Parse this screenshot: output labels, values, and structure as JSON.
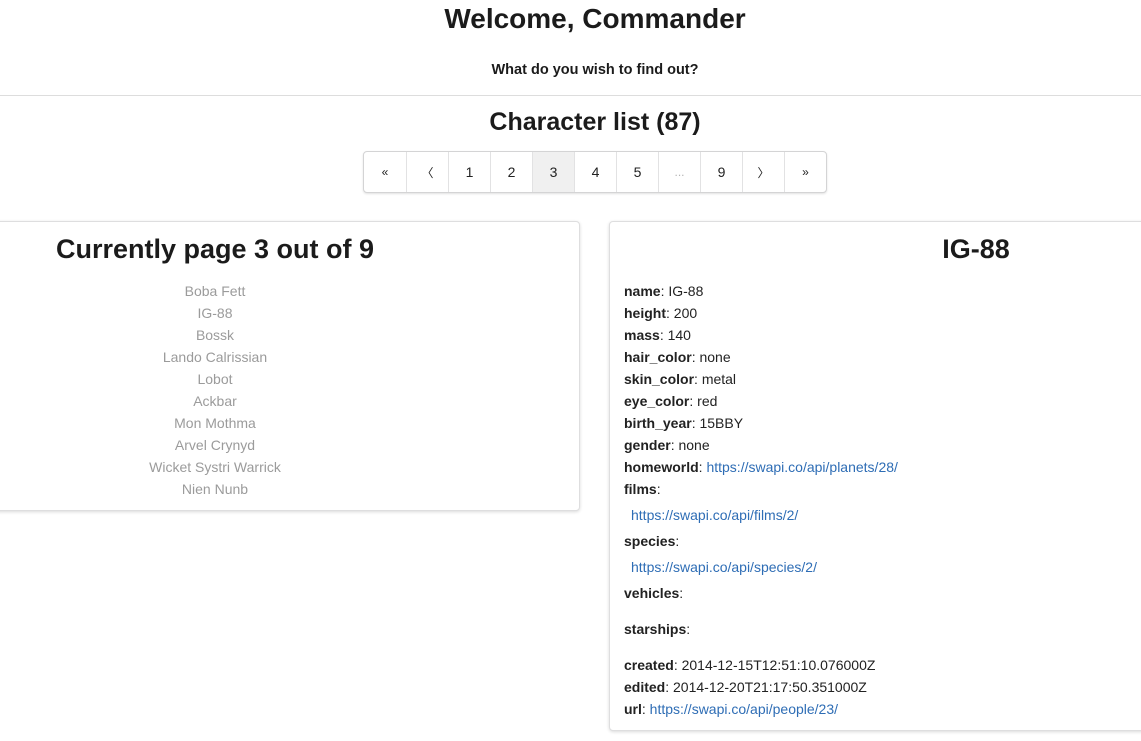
{
  "header": {
    "welcome": "Welcome, Commander",
    "subtitle": "What do you wish to find out?"
  },
  "list": {
    "title": "Character list (87)"
  },
  "pagination": {
    "first": "«",
    "prev": "〈",
    "pages": [
      "1",
      "2",
      "3",
      "4",
      "5"
    ],
    "ellipsis": "...",
    "last_page": "9",
    "next": "〉",
    "last": "»",
    "active_page": "3"
  },
  "left": {
    "heading": "Currently page 3 out of 9",
    "characters": [
      "Boba Fett",
      "IG-88",
      "Bossk",
      "Lando Calrissian",
      "Lobot",
      "Ackbar",
      "Mon Mothma",
      "Arvel Crynyd",
      "Wicket Systri Warrick",
      "Nien Nunb"
    ]
  },
  "detail": {
    "title": "IG-88",
    "name": {
      "key": "name",
      "value": "IG-88"
    },
    "height": {
      "key": "height",
      "value": "200"
    },
    "mass": {
      "key": "mass",
      "value": "140"
    },
    "hair_color": {
      "key": "hair_color",
      "value": "none"
    },
    "skin_color": {
      "key": "skin_color",
      "value": "metal"
    },
    "eye_color": {
      "key": "eye_color",
      "value": "red"
    },
    "birth_year": {
      "key": "birth_year",
      "value": "15BBY"
    },
    "gender": {
      "key": "gender",
      "value": "none"
    },
    "homeworld": {
      "key": "homeworld",
      "value": "https://swapi.co/api/planets/28/"
    },
    "films": {
      "key": "films",
      "items": [
        "https://swapi.co/api/films/2/"
      ]
    },
    "species": {
      "key": "species",
      "items": [
        "https://swapi.co/api/species/2/"
      ]
    },
    "vehicles": {
      "key": "vehicles"
    },
    "starships": {
      "key": "starships"
    },
    "created": {
      "key": "created",
      "value": "2014-12-15T12:51:10.076000Z"
    },
    "edited": {
      "key": "edited",
      "value": "2014-12-20T21:17:50.351000Z"
    },
    "url": {
      "key": "url",
      "value": "https://swapi.co/api/people/23/"
    }
  },
  "colors": {
    "link": "#2e6db5",
    "muted_text": "#9b9b9b",
    "active_page_bg": "#f0f0f0"
  }
}
